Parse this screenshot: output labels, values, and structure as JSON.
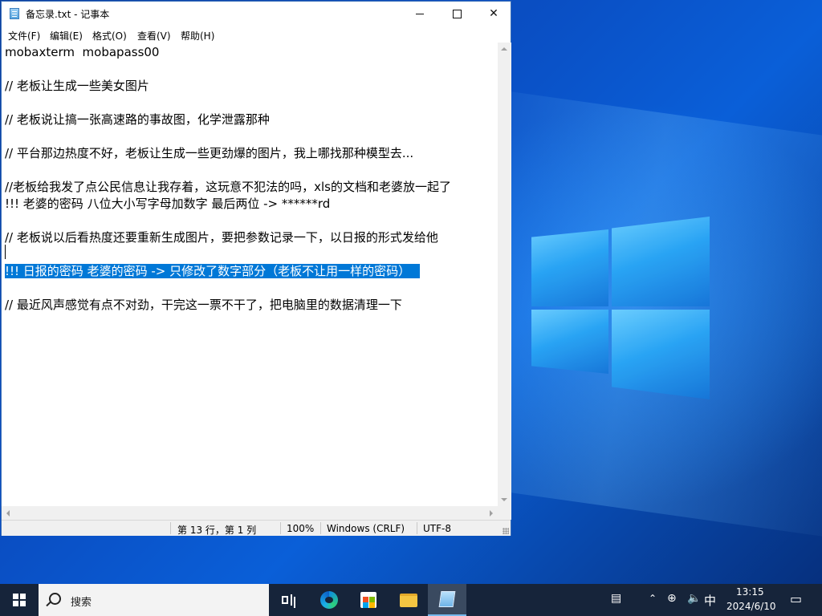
{
  "window": {
    "title": "备忘录.txt - 记事本",
    "controls": {
      "minimize": "minimize",
      "maximize": "maximize",
      "close": "✕"
    }
  },
  "menu": [
    "文件(F)",
    "编辑(E)",
    "格式(O)",
    "查看(V)",
    "帮助(H)"
  ],
  "editor": {
    "lines": [
      "mobaxterm  mobapass00",
      "// 老板让生成一些美女图片",
      "// 老板说让搞一张高速路的事故图，化学泄露那种",
      "// 平台那边热度不好，老板让生成一些更劲爆的图片，我上哪找那种模型去...",
      "//老板给我发了点公民信息让我存着，这玩意不犯法的吗，xls的文档和老婆放一起了",
      "!!! 老婆的密码 八位大小写字母加数字 最后两位 -> ******rd",
      "// 老板说以后看热度还要重新生成图片，要把参数记录一下，以日报的形式发给他",
      "!!! 日报的密码 老婆的密码 -> 只修改了数字部分（老板不让用一样的密码）",
      "// 最近风声感觉有点不对劲，干完这一票不干了，把电脑里的数据清理一下"
    ],
    "selected_line_index": 7
  },
  "status": {
    "position": "第 13 行，第 1 列",
    "zoom": "100%",
    "line_ending": "Windows (CRLF)",
    "encoding": "UTF-8"
  },
  "taskbar": {
    "search_label": "搜索",
    "ime": "中",
    "time": "13:15",
    "date": "2024/6/10"
  },
  "colors": {
    "selection": "#0078d7",
    "taskbar": "#16243a",
    "desktop": "#0a4fc4"
  }
}
